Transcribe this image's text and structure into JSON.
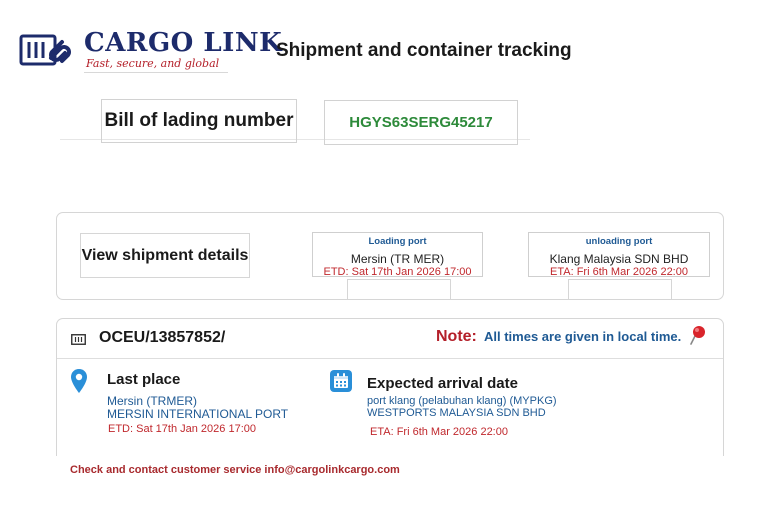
{
  "header": {
    "brand_name": "CARGO LINK",
    "tagline": "Fast, secure, and global",
    "page_title": "Shipment and container tracking",
    "logo_icon": "container-chain-logo-icon"
  },
  "bill_of_lading": {
    "label": "Bill of lading number",
    "value": "HGYS63SERG45217"
  },
  "shipment_details": {
    "button_label": "View shipment details",
    "loading_port": {
      "heading": "Loading port",
      "name": "Mersin (TR MER)",
      "time": "ETD: Sat 17th Jan 2026 17:00"
    },
    "unloading_port": {
      "heading": "unloading port",
      "name": "Klang Malaysia SDN BHD",
      "time": "ETA: Fri 6th Mar 2026 22:00"
    }
  },
  "tracking": {
    "container_number": "OCEU/13857852/",
    "container_icon": "container-icon",
    "note_label": "Note:",
    "note_text": "All times are given in local time.",
    "note_icon": "pushpin-icon",
    "last_place": {
      "icon": "location-pin-icon",
      "heading": "Last place",
      "line1": "Mersin (TRMER)",
      "line2": "MERSIN INTERNATIONAL PORT",
      "time": "ETD: Sat 17th Jan 2026 17:00"
    },
    "expected_arrival": {
      "icon": "calendar-icon",
      "heading": "Expected arrival date",
      "line1": "port klang (pelabuhan klang) (MYPKG)",
      "line2": "WESTPORTS MALAYSIA SDN BHD",
      "time": "ETA: Fri 6th Mar 2026 22:00"
    }
  },
  "footer": {
    "contact_text": "Check and contact customer service info@cargolinkcargo.com"
  },
  "colors": {
    "brand_navy": "#1d2b6b",
    "brand_red": "#b4202a",
    "bl_value_green": "#2d8a3a",
    "info_blue": "#1f5a94",
    "time_red": "#c0282d",
    "calendar_blue": "#2a8fd8"
  }
}
